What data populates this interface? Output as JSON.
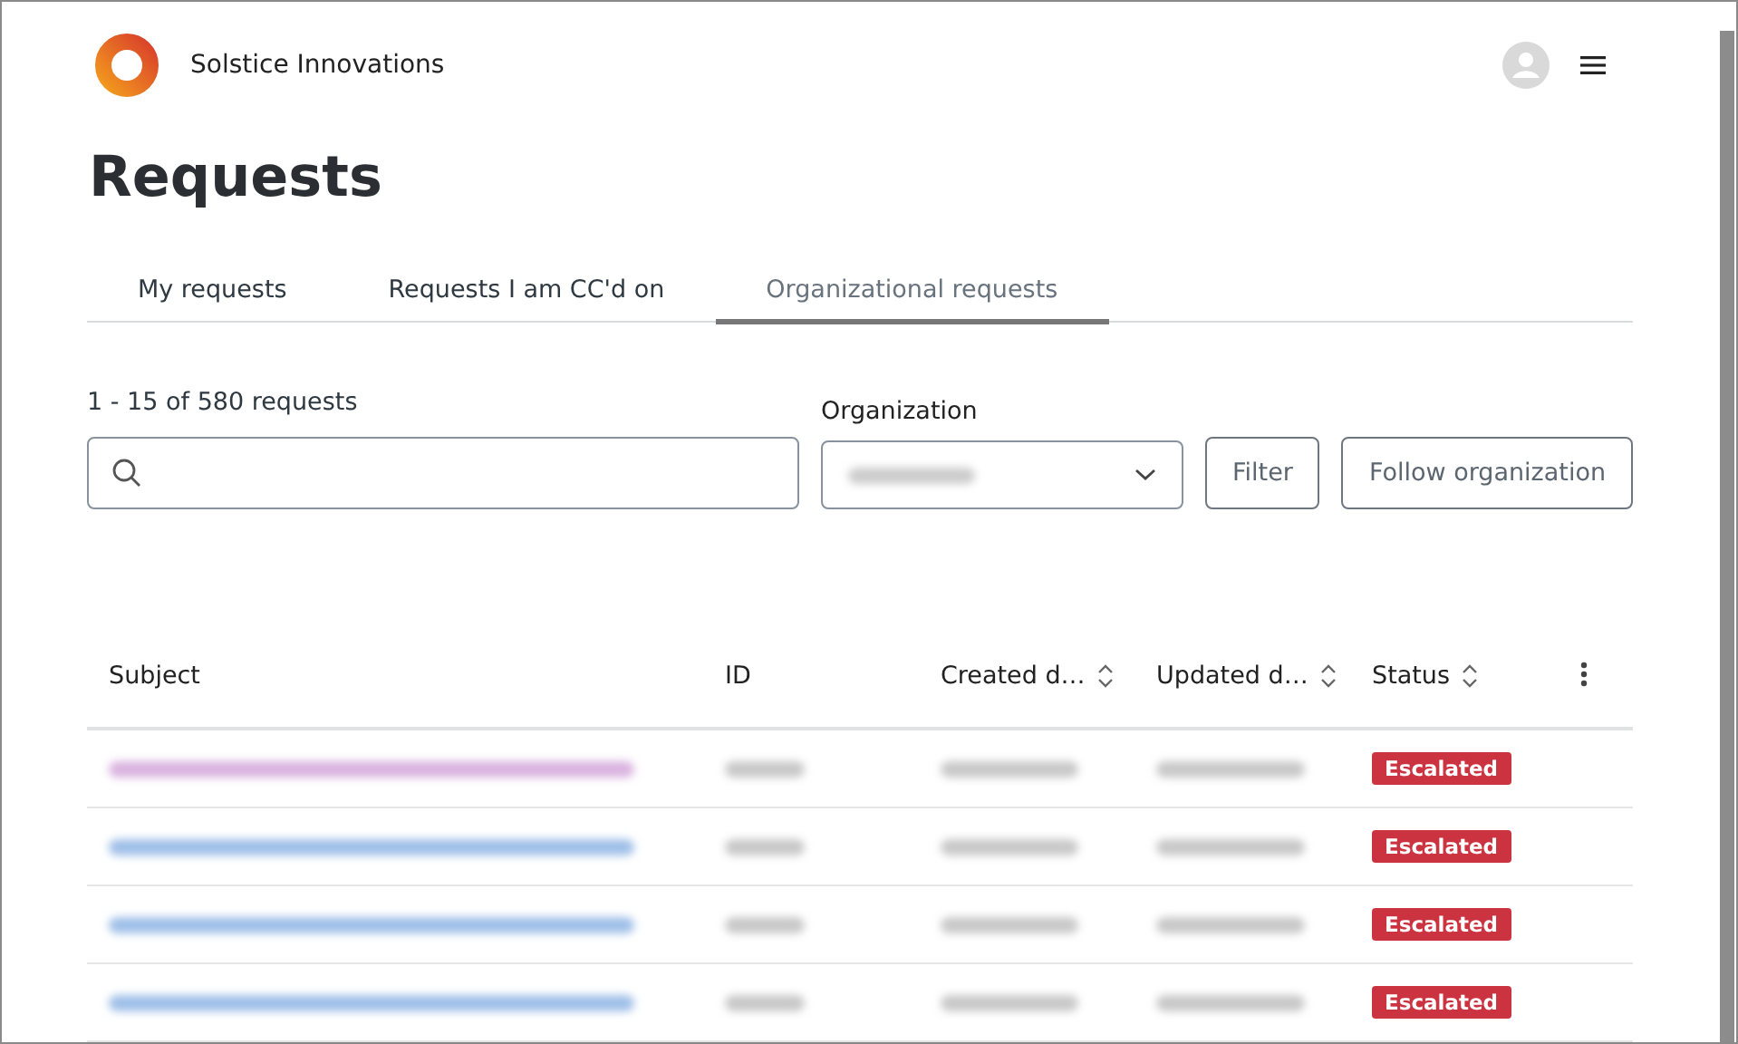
{
  "header": {
    "brand": "Solstice Innovations"
  },
  "page_title": "Requests",
  "tabs": [
    {
      "label": "My requests",
      "selected": false
    },
    {
      "label": "Requests I am CC'd on",
      "selected": false
    },
    {
      "label": "Organizational requests",
      "selected": true
    }
  ],
  "results_count": "1 - 15 of 580 requests",
  "organization": {
    "label": "Organization"
  },
  "buttons": [
    "Filter",
    "Follow organization"
  ],
  "table": {
    "columns": [
      {
        "label": "Subject",
        "sortable": false
      },
      {
        "label": "ID",
        "sortable": false
      },
      {
        "label": "Created d…",
        "sortable": true
      },
      {
        "label": "Updated d…",
        "sortable": true
      },
      {
        "label": "Status",
        "sortable": true
      }
    ],
    "rows": [
      {
        "visited": true,
        "status": "Escalated"
      },
      {
        "visited": false,
        "status": "Escalated"
      },
      {
        "visited": false,
        "status": "Escalated"
      },
      {
        "visited": false,
        "status": "Escalated"
      }
    ]
  }
}
